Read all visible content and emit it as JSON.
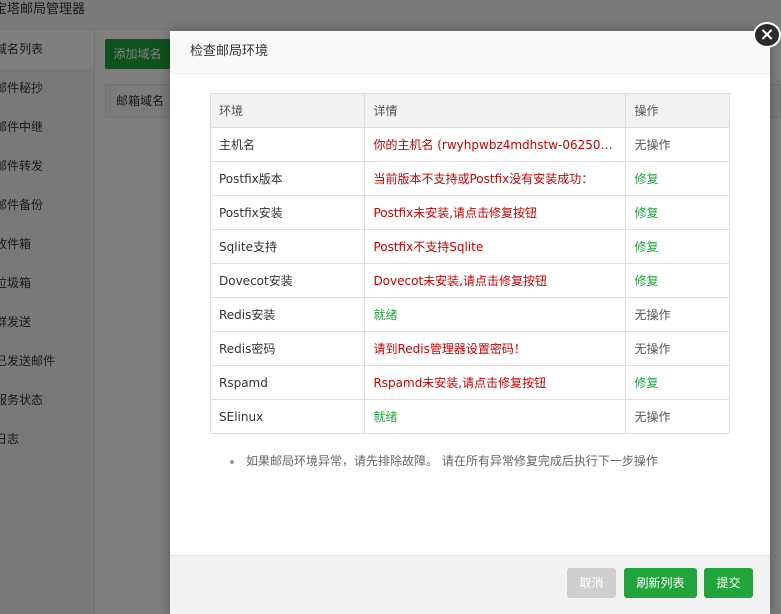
{
  "app": {
    "title": "宝塔邮局管理器",
    "sidebar": [
      "域名列表",
      "邮件秘抄",
      "邮件中继",
      "邮件转发",
      "邮件备份",
      "收件箱",
      "垃圾箱",
      "群发送",
      "已发送邮件",
      "服务状态",
      "日志"
    ],
    "add_domain_button": "添加域名",
    "table_header_first": "邮箱域名"
  },
  "modal": {
    "title": "检查邮局环境",
    "close_glyph": "×",
    "table": {
      "headers": [
        "环境",
        "详情",
        "操作"
      ],
      "rows": [
        {
          "env": "主机名",
          "detail": "你的主机名 (rwyhpwbz4mdhstw-062505...",
          "detail_status": "error",
          "op": "无操作",
          "op_type": "none"
        },
        {
          "env": "Postfix版本",
          "detail": "当前版本不支持或Postfix没有安装成功：",
          "detail_status": "error",
          "op": "修复",
          "op_type": "fix"
        },
        {
          "env": "Postfix安装",
          "detail": "Postfix未安装,请点击修复按钮",
          "detail_status": "error",
          "op": "修复",
          "op_type": "fix"
        },
        {
          "env": "Sqlite支持",
          "detail": "Postfix不支持Sqlite",
          "detail_status": "error",
          "op": "修复",
          "op_type": "fix"
        },
        {
          "env": "Dovecot安装",
          "detail": "Dovecot未安装,请点击修复按钮",
          "detail_status": "error",
          "op": "修复",
          "op_type": "fix"
        },
        {
          "env": "Redis安装",
          "detail": "就绪",
          "detail_status": "ok",
          "op": "无操作",
          "op_type": "none"
        },
        {
          "env": "Redis密码",
          "detail": "请到Redis管理器设置密码！",
          "detail_status": "error",
          "op": "无操作",
          "op_type": "none"
        },
        {
          "env": "Rspamd",
          "detail": "Rspamd未安装,请点击修复按钮",
          "detail_status": "error",
          "op": "修复",
          "op_type": "fix"
        },
        {
          "env": "SElinux",
          "detail": "就绪",
          "detail_status": "ok",
          "op": "无操作",
          "op_type": "none"
        }
      ]
    },
    "tip": "如果邮局环境异常，请先排除故障。 请在所有异常修复完成后执行下一步操作",
    "buttons": {
      "cancel": "取消",
      "refresh": "刷新列表",
      "submit": "提交"
    }
  },
  "colors": {
    "accent": "#20a53a",
    "error": "#cc0000",
    "disabled": "#cfcfcf"
  }
}
